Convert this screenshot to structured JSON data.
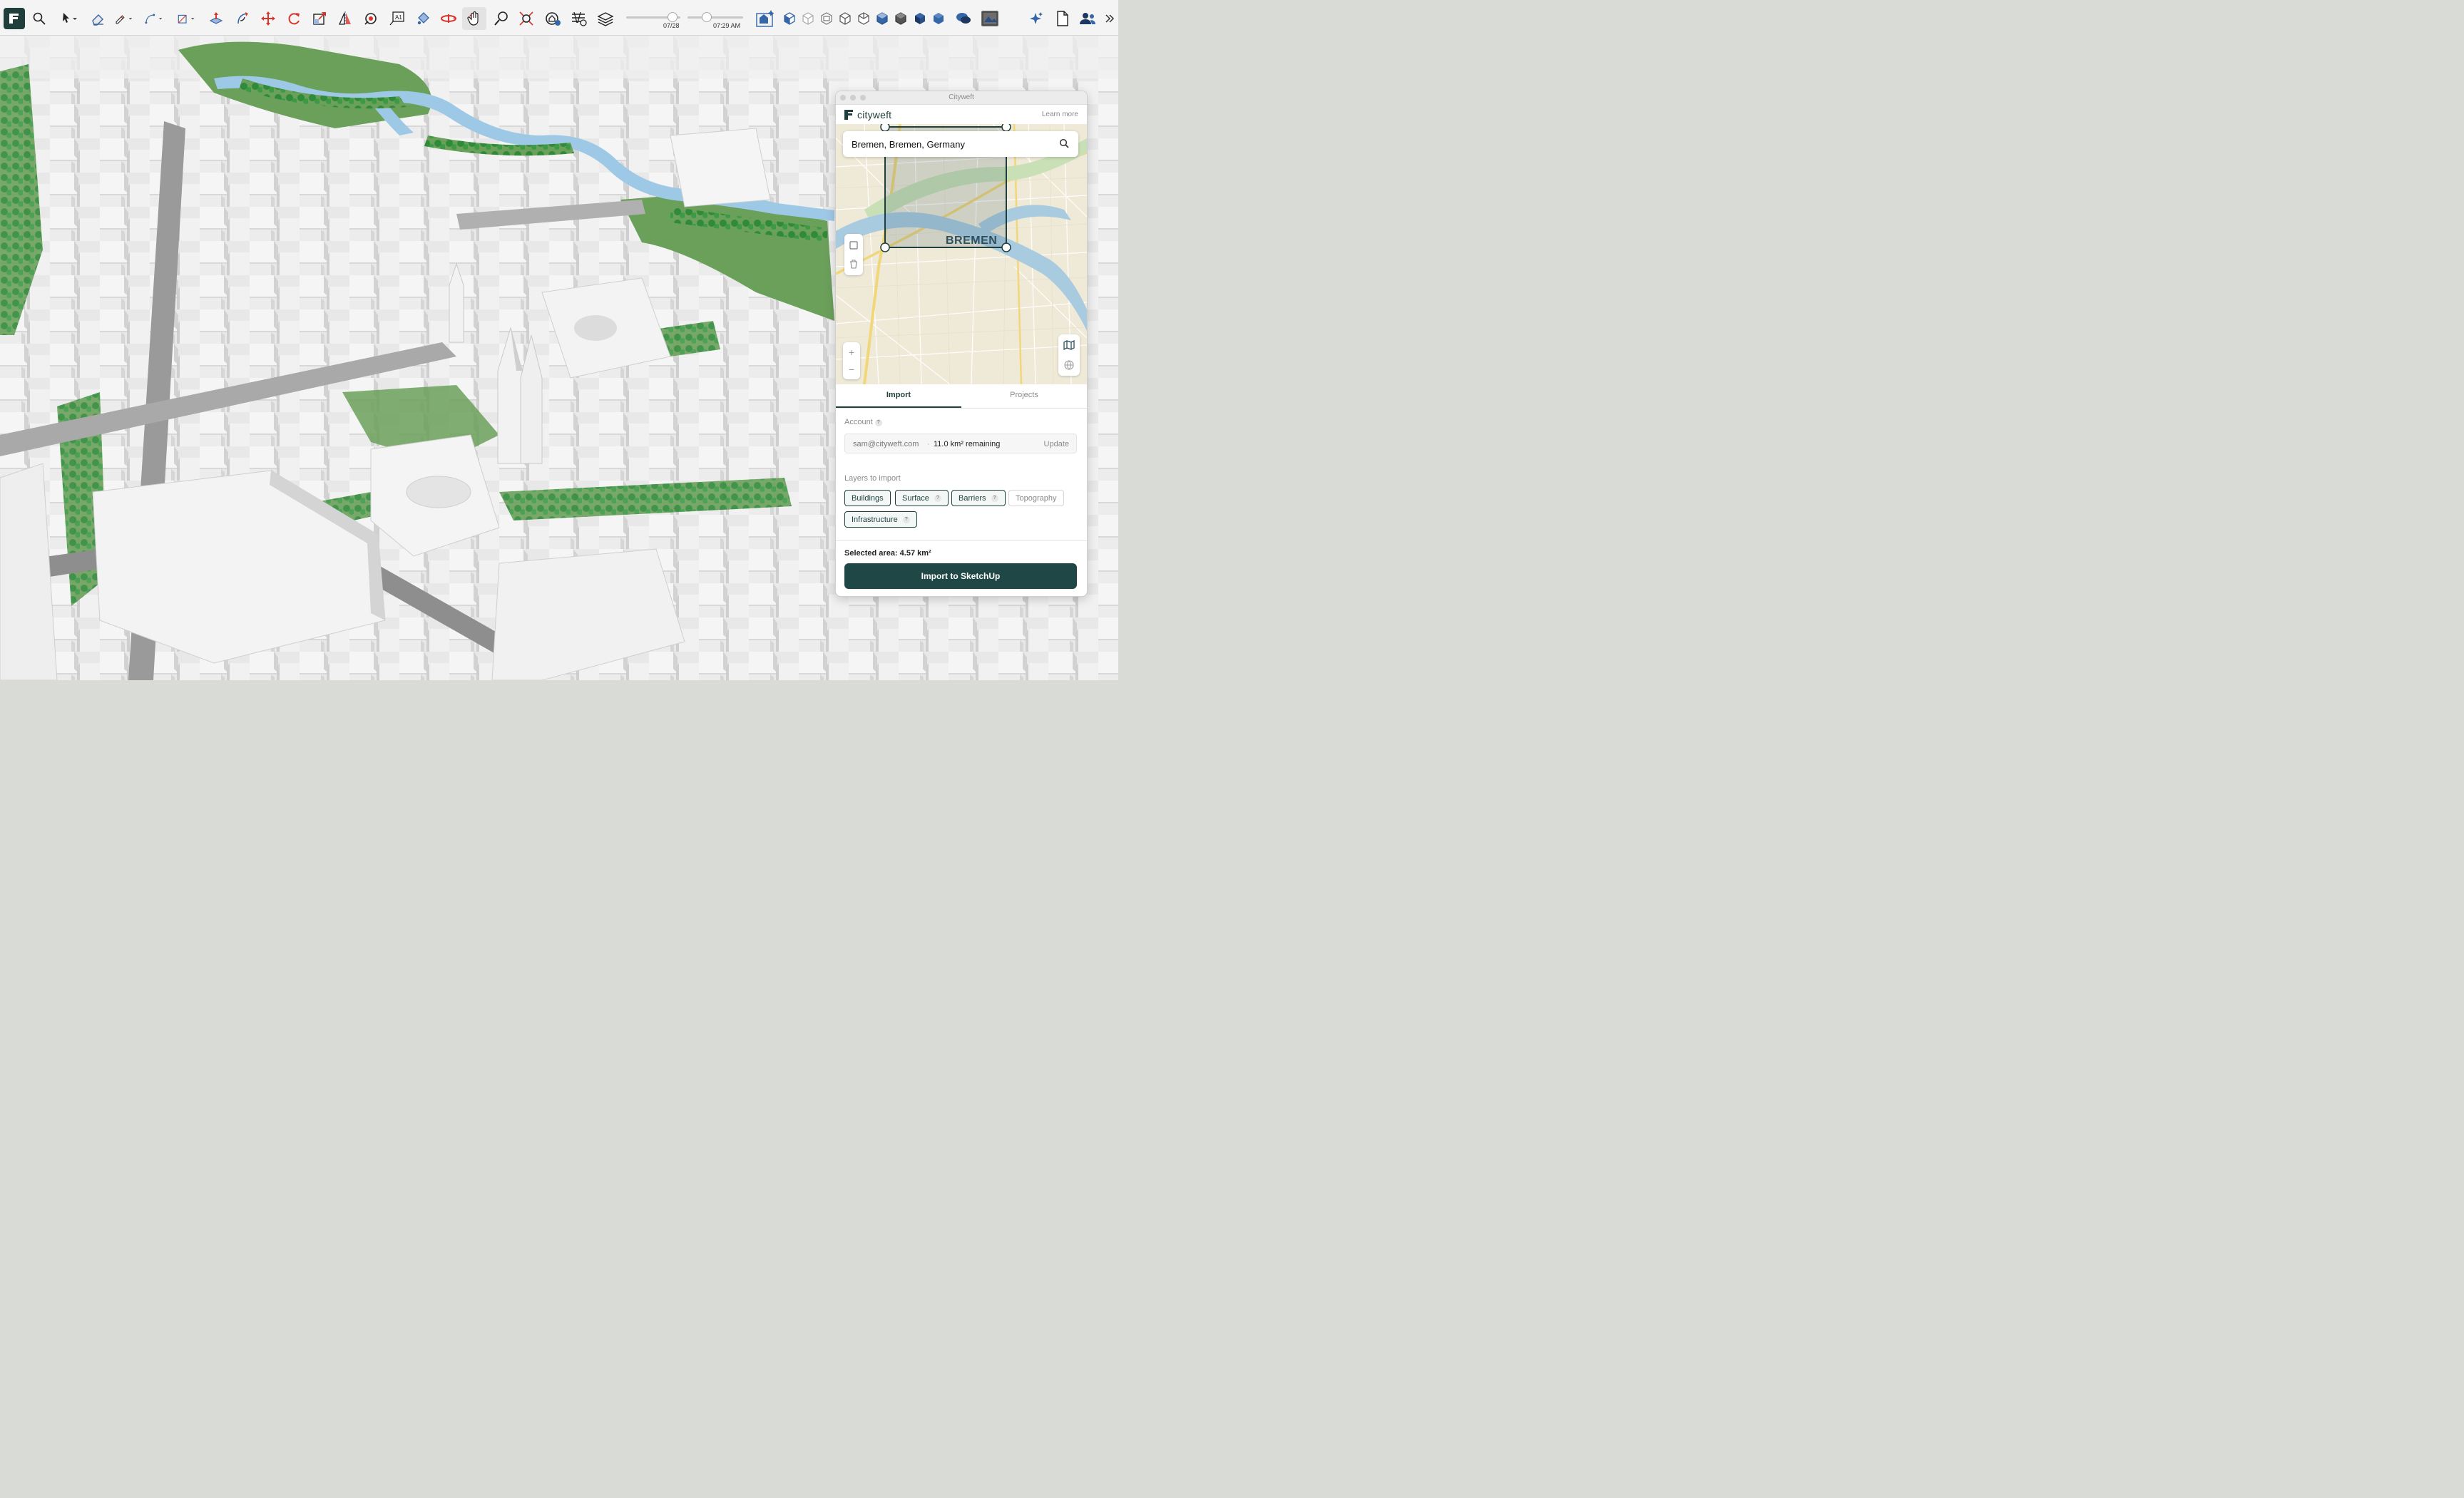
{
  "toolbar": {
    "time_slider": {
      "label": "07/28",
      "value": 0.85
    },
    "date_slider": {
      "label": "07:29 AM",
      "value": 0.35
    }
  },
  "panel": {
    "window_title": "Cityweft",
    "brand": "cityweft",
    "learn_more": "Learn more",
    "search": {
      "value": "Bremen, Bremen, Germany",
      "icon": "search-icon"
    },
    "map": {
      "label": "BREMEN"
    },
    "tabs": [
      {
        "label": "Import",
        "active": true
      },
      {
        "label": "Projects",
        "active": false
      }
    ],
    "account": {
      "label": "Account",
      "email": "sam@cityweft.com",
      "separator": "·",
      "remaining": "11.0 km² remaining",
      "update": "Update"
    },
    "layers": {
      "label": "Layers to import",
      "items": [
        {
          "label": "Buildings",
          "selected": true,
          "help": false
        },
        {
          "label": "Surface",
          "selected": true,
          "help": true
        },
        {
          "label": "Barriers",
          "selected": true,
          "help": true
        },
        {
          "label": "Topography",
          "selected": false,
          "help": false
        },
        {
          "label": "Infrastructure",
          "selected": true,
          "help": true
        }
      ]
    },
    "help_glyph": "?",
    "selected_area": "Selected area: 4.57 km²",
    "import_button": "Import to SketchUp"
  },
  "colors": {
    "brand": "#1f3e3c",
    "button": "#1f4745",
    "accent_red": "#d9342b"
  }
}
